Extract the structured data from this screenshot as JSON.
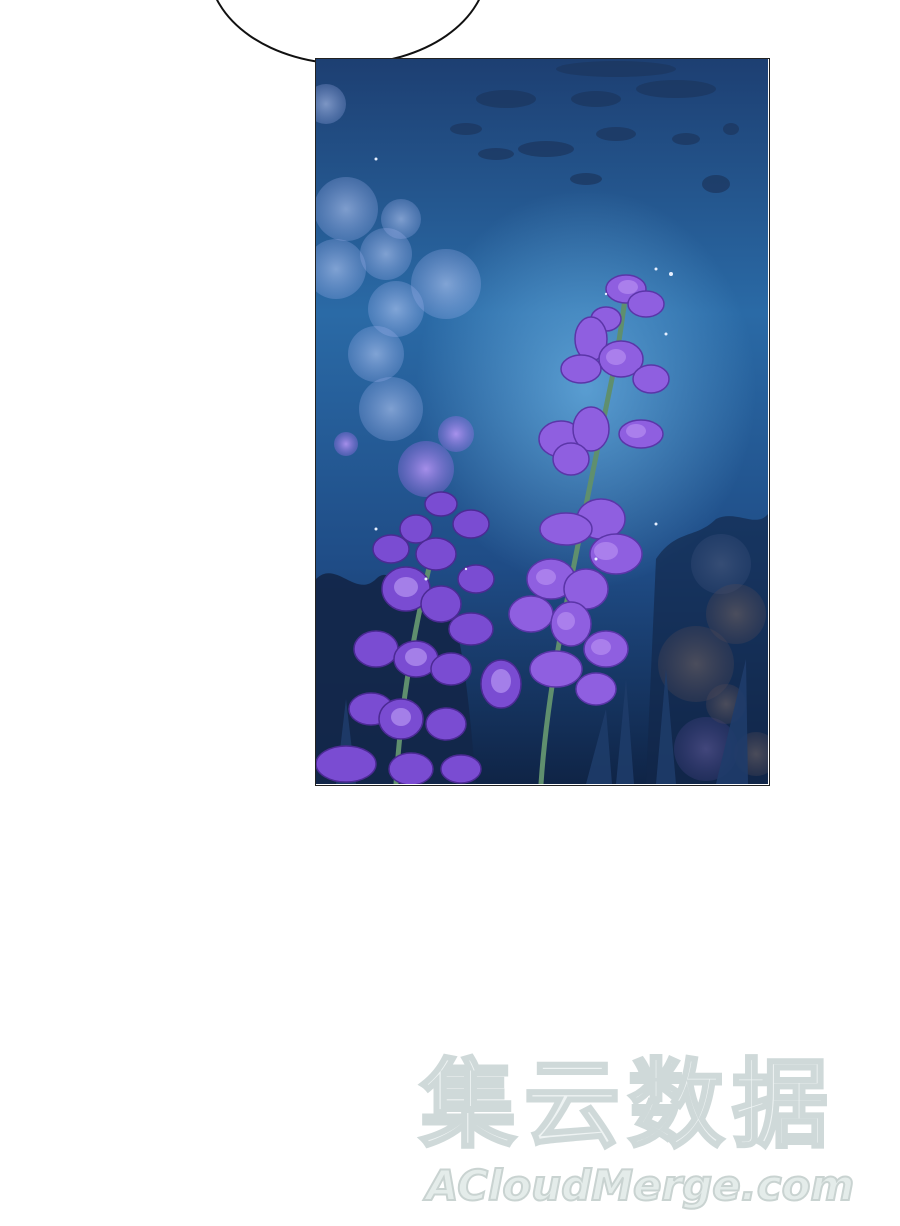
{
  "watermark": {
    "chinese_text": "集云数据",
    "english_text": "ACloudMerge.com"
  },
  "colors": {
    "background": "#ffffff",
    "sky_top": "#1c3f73",
    "sky_mid": "#2a6aa8",
    "sky_bottom": "#123056",
    "flower_purple": "#8a56d6",
    "flower_light": "#b38af0",
    "stem_green": "#5f8f6e",
    "bokeh_blue": "#9fb8f0",
    "bokeh_orange": "#e0a878"
  },
  "panel": {
    "scene": "lavender-flowers-night"
  }
}
